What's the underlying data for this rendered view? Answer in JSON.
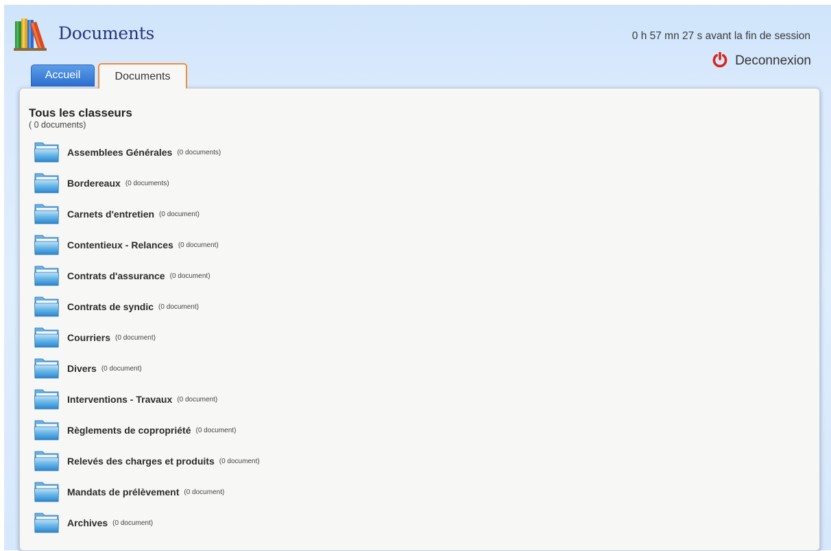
{
  "header": {
    "title": "Documents",
    "session_timer": "0 h 57 mn 27 s avant la fin de session",
    "logout_label": "Deconnexion"
  },
  "tabs": [
    {
      "label": "Accueil",
      "active": false
    },
    {
      "label": "Documents",
      "active": true
    }
  ],
  "main": {
    "title": "Tous les classeurs",
    "count": "( 0 documents)",
    "folders": [
      {
        "name": "Assemblees Générales",
        "count": "(0 documents)"
      },
      {
        "name": "Bordereaux",
        "count": "(0 documents)"
      },
      {
        "name": "Carnets d'entretien",
        "count": "(0 document)"
      },
      {
        "name": "Contentieux - Relances",
        "count": "(0 document)"
      },
      {
        "name": "Contrats d'assurance",
        "count": "(0 document)"
      },
      {
        "name": "Contrats de syndic",
        "count": "(0 document)"
      },
      {
        "name": "Courriers",
        "count": "(0 document)"
      },
      {
        "name": "Divers",
        "count": "(0 document)"
      },
      {
        "name": "Interventions - Travaux",
        "count": "(0 document)"
      },
      {
        "name": "Règlements de copropriété",
        "count": "(0 document)"
      },
      {
        "name": "Relevés des charges et produits",
        "count": "(0 document)"
      },
      {
        "name": "Mandats de prélèvement",
        "count": "(0 document)"
      },
      {
        "name": "Archives",
        "count": "(0 document)"
      }
    ]
  },
  "icons": {
    "logo": "books-icon",
    "logout": "power-icon",
    "folder": "folder-icon"
  },
  "colors": {
    "title": "#27347a",
    "active_tab_border": "#f08d3c",
    "tab_blue": "#2d6fcf",
    "power_red": "#d7261b",
    "folder_blue": "#3a97d8"
  }
}
